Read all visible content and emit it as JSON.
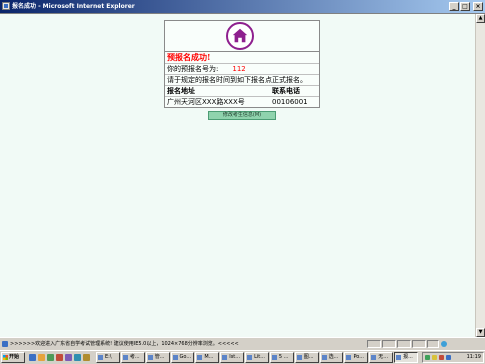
{
  "window": {
    "title": "报名成功 - Microsoft Internet Explorer",
    "buttons": {
      "minimize": "_",
      "maximize": "□",
      "close": "×"
    }
  },
  "content": {
    "success_title": "预报名成功!",
    "number_label": "你的预报名号为:",
    "number_value": "112",
    "instruction": "请于规定的报名时间到如下报名点正式报名。",
    "table_headers": {
      "address": "报名地址",
      "phone": "联系电话"
    },
    "row": {
      "address": "广州天河区XXX路XXX号",
      "phone": "00106001"
    },
    "action_button": "修改考生信息(M)"
  },
  "status_bar": {
    "text": ">>>>>>欢迎进入广东省自学考试管理系统! 建议使用IE5.0以上，1024×768分辨率浏览。<<<<<"
  },
  "taskbar": {
    "start": "开始",
    "tasks": [
      "E:\\",
      "考...",
      "管...",
      "Go...",
      "M...",
      "Ist...",
      "Lit...",
      "5 ...",
      "图...",
      "选...",
      "Po...",
      "无...",
      "报..."
    ],
    "active_index": 12,
    "clock": "11:19"
  },
  "scrollbar": {
    "up": "▲",
    "down": "▼"
  },
  "colors": {
    "page_bg": "#f1faf6",
    "accent": "#8e1f8e",
    "alert": "#ff0000",
    "button_bg": "#8fd3ad",
    "titlebar": "#0a246a"
  },
  "icons": {
    "logo": "home-icon",
    "start": "windows-logo-icon"
  }
}
